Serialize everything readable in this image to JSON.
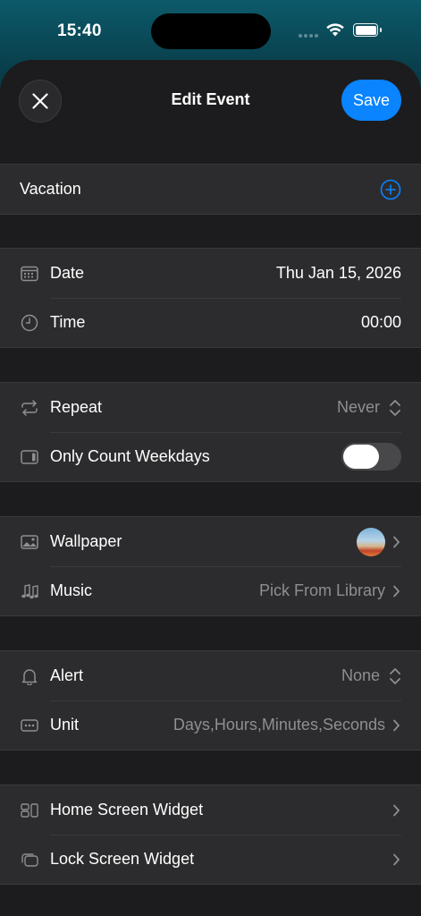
{
  "status_bar": {
    "time": "15:40"
  },
  "header": {
    "title": "Edit Event",
    "save_label": "Save"
  },
  "event_name": {
    "value": "Vacation"
  },
  "date_time": {
    "date_label": "Date",
    "date_value": "Thu Jan 15, 2026",
    "time_label": "Time",
    "time_value": "00:00"
  },
  "repeat": {
    "repeat_label": "Repeat",
    "repeat_value": "Never",
    "weekdays_label": "Only Count Weekdays",
    "weekdays_on": false
  },
  "media": {
    "wallpaper_label": "Wallpaper",
    "music_label": "Music",
    "music_value": "Pick From Library"
  },
  "alerts": {
    "alert_label": "Alert",
    "alert_value": "None",
    "unit_label": "Unit",
    "unit_value": "Days,Hours,Minutes,Seconds"
  },
  "widgets": {
    "home_label": "Home Screen Widget",
    "lock_label": "Lock Screen Widget"
  },
  "colors": {
    "accent": "#0a84ff",
    "background": "#1c1c1e",
    "cell": "#2c2c2e"
  }
}
